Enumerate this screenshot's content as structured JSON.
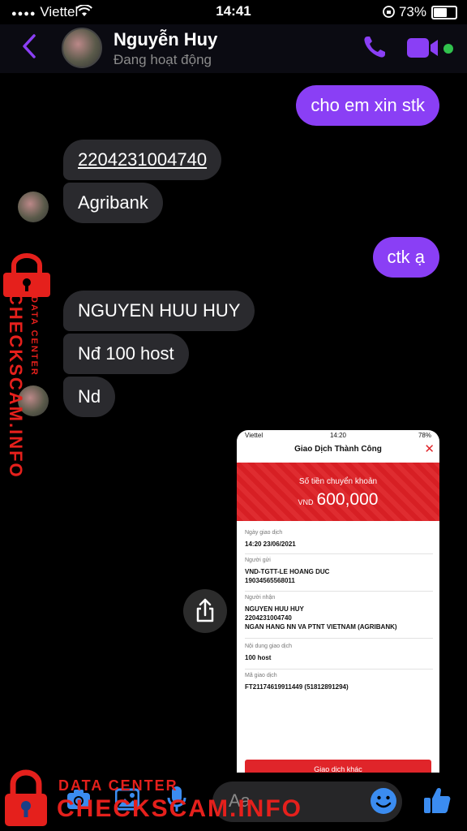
{
  "status_bar": {
    "carrier": "Viettel",
    "time": "14:41",
    "battery": "73%",
    "battery_level": 0.73
  },
  "header": {
    "name": "Nguyễn Huy",
    "status": "Đang hoạt động"
  },
  "messages": [
    {
      "dir": "sent",
      "text": "cho em xin stk"
    },
    {
      "dir": "recv",
      "text": "2204231004740"
    },
    {
      "dir": "recv",
      "text": "Agribank"
    },
    {
      "dir": "sent",
      "text": "ctk ạ"
    },
    {
      "dir": "recv",
      "text": "NGUYEN HUU HUY"
    },
    {
      "dir": "recv",
      "text": "Nđ 100 host"
    },
    {
      "dir": "recv",
      "text": "Nd"
    }
  ],
  "receipt": {
    "status_carrier": "Viettel",
    "status_time": "14:20",
    "status_battery": "78%",
    "title": "Giao Dịch Thành Công",
    "amount_label": "Số tiền chuyển khoản",
    "currency": "VND",
    "amount": "600,000",
    "fields": [
      {
        "label": "Ngày giao dịch",
        "lines": [
          "14:20 23/06/2021"
        ]
      },
      {
        "label": "Người gửi",
        "lines": [
          "VND-TGTT-LE HOANG DUC",
          "19034565568011"
        ]
      },
      {
        "label": "Người nhận",
        "lines": [
          "NGUYEN HUU HUY",
          "2204231004740",
          "NGAN HANG NN VA PTNT VIETNAM (AGRIBANK)"
        ]
      },
      {
        "label": "Nội dung giao dịch",
        "lines": [
          "100 host"
        ]
      },
      {
        "label": "Mã giao dịch",
        "lines": [
          "FT21174619911449 (51812891294)"
        ]
      }
    ],
    "button": "Giao dịch khác"
  },
  "watermark": {
    "vertical_main": "CHECKSCAM.INFO",
    "vertical_small": "DATA CENTER",
    "bottom_small": "DATA CENTER",
    "bottom_main": "CHECKSCAM.INFO"
  },
  "composer": {
    "placeholder": "Aa"
  },
  "colors": {
    "accent": "#8a3ff5",
    "received_bubble": "#2a2a2e",
    "watermark": "#e5201c",
    "bank_red": "#e0252a"
  }
}
